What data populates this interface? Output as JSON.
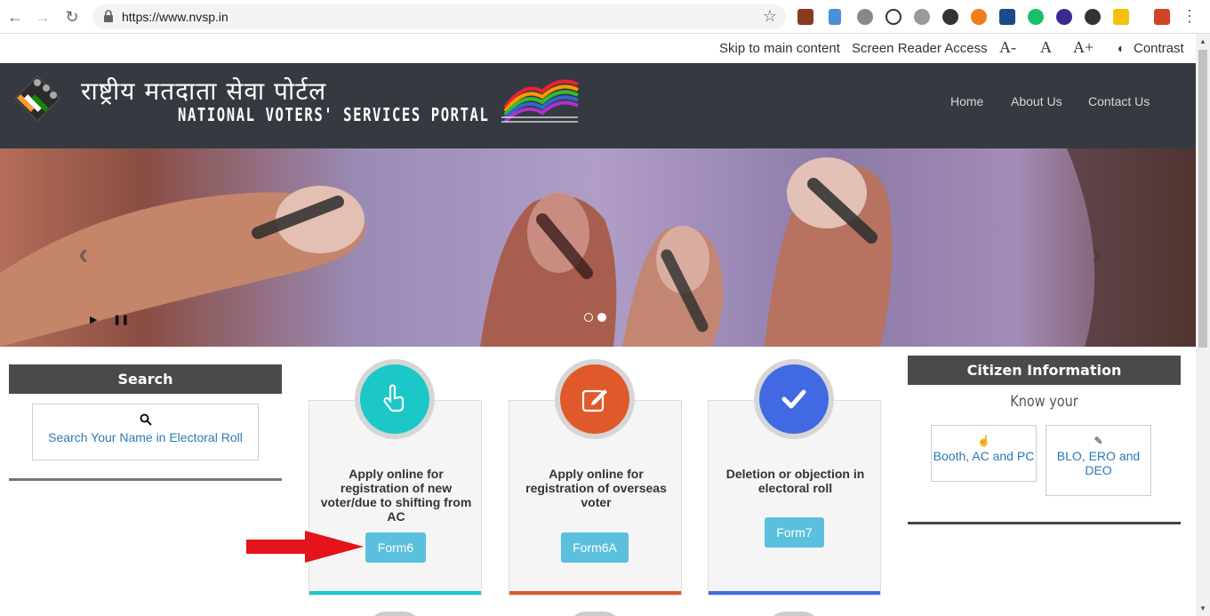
{
  "browser": {
    "url": "https://www.nvsp.in",
    "extension_icons": [
      "desc-icon",
      "eyedropper-icon",
      "bike-icon",
      "speedometer-icon",
      "globe-icon",
      "color-icon",
      "b-icon",
      "shield-icon",
      "grammarly-icon",
      "gem-icon",
      "k-icon",
      "cube-icon",
      "office-icon"
    ]
  },
  "accessibility_bar": {
    "skip": "Skip to main content",
    "screen_reader": "Screen Reader Access",
    "font_decrease": "A-",
    "font_normal": "A",
    "font_increase": "A+",
    "contrast": "Contrast"
  },
  "header": {
    "title_hindi": "राष्ट्रीय मतदाता सेवा पोर्टल",
    "title_english": "NATIONAL VOTERS' SERVICES PORTAL",
    "nav": [
      "Home",
      "About Us",
      "Contact Us"
    ]
  },
  "search_panel": {
    "heading": "Search",
    "link": "Search Your Name in Electoral Roll"
  },
  "cards": [
    {
      "text": "Apply online for registration of new voter/due to shifting from AC",
      "button": "Form6",
      "color": "#1cc7c7",
      "icon": "hand-pointer-icon"
    },
    {
      "text": "Apply online for registration of overseas voter",
      "button": "Form6A",
      "color": "#e0592a",
      "icon": "edit-icon"
    },
    {
      "text": "Deletion or objection in electoral roll",
      "button": "Form7",
      "color": "#4169e1",
      "icon": "check-icon"
    }
  ],
  "citizen_info": {
    "heading": "Citizen Information",
    "subheading": "Know your",
    "items": [
      "Booth, AC and PC",
      "BLO, ERO and DEO"
    ]
  }
}
